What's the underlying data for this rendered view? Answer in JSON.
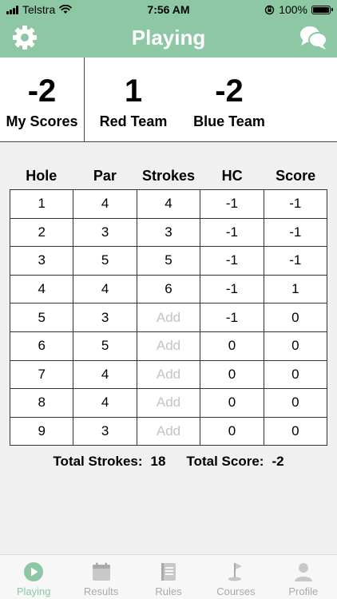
{
  "status_bar": {
    "carrier": "Telstra",
    "time": "7:56 AM",
    "battery": "100%"
  },
  "nav": {
    "title": "Playing",
    "left_icon": "gear-icon",
    "right_icon": "chat-icon"
  },
  "scores": {
    "mine": {
      "value": "-2",
      "label": "My Scores"
    },
    "red": {
      "value": "1",
      "label": "Red Team"
    },
    "blue": {
      "value": "-2",
      "label": "Blue Team"
    }
  },
  "table": {
    "headers": [
      "Hole",
      "Par",
      "Strokes",
      "HC",
      "Score"
    ],
    "rows": [
      {
        "hole": "1",
        "par": "4",
        "strokes": "4",
        "hc": "-1",
        "score": "-1"
      },
      {
        "hole": "2",
        "par": "3",
        "strokes": "3",
        "hc": "-1",
        "score": "-1"
      },
      {
        "hole": "3",
        "par": "5",
        "strokes": "5",
        "hc": "-1",
        "score": "-1"
      },
      {
        "hole": "4",
        "par": "4",
        "strokes": "6",
        "hc": "-1",
        "score": "1"
      },
      {
        "hole": "5",
        "par": "3",
        "strokes": "",
        "strokes_placeholder": "Add",
        "hc": "-1",
        "score": "0"
      },
      {
        "hole": "6",
        "par": "5",
        "strokes": "",
        "strokes_placeholder": "Add",
        "hc": "0",
        "score": "0"
      },
      {
        "hole": "7",
        "par": "4",
        "strokes": "",
        "strokes_placeholder": "Add",
        "hc": "0",
        "score": "0"
      },
      {
        "hole": "8",
        "par": "4",
        "strokes": "",
        "strokes_placeholder": "Add",
        "hc": "0",
        "score": "0"
      },
      {
        "hole": "9",
        "par": "3",
        "strokes": "",
        "strokes_placeholder": "Add",
        "hc": "0",
        "score": "0"
      }
    ]
  },
  "totals": {
    "strokes_label": "Total Strokes:",
    "strokes_value": "18",
    "score_label": "Total Score:",
    "score_value": "-2"
  },
  "tabs": [
    {
      "label": "Playing",
      "icon": "play-icon",
      "active": true
    },
    {
      "label": "Results",
      "icon": "calendar-icon",
      "active": false
    },
    {
      "label": "Rules",
      "icon": "book-icon",
      "active": false
    },
    {
      "label": "Courses",
      "icon": "golf-flag-icon",
      "active": false
    },
    {
      "label": "Profile",
      "icon": "person-icon",
      "active": false
    }
  ],
  "colors": {
    "accent": "#8dc7a4",
    "inactive_tab": "#a9a9a9",
    "placeholder": "#c4c4c4"
  }
}
